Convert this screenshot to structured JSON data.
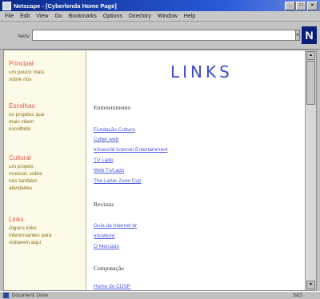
{
  "window": {
    "title": "Netscape - [Cyberlenda Home Page]",
    "min": "_",
    "max": "□",
    "close": "×"
  },
  "menu": [
    "File",
    "Edit",
    "View",
    "Go",
    "Bookmarks",
    "Options",
    "Directory",
    "Window",
    "Help"
  ],
  "toolbar": {
    "address_label": "Netsi",
    "address_value": "",
    "logo": "N",
    "dropdown": "▾"
  },
  "sidebar": [
    {
      "title": "Principal",
      "links": [
        "um pouco mais",
        "sobre nós"
      ]
    },
    {
      "title": "Escolhas",
      "links": [
        "os projetos que",
        "mais vêem",
        "escolhido"
      ]
    },
    {
      "title": "Cultural",
      "links": [
        "um projeto",
        "musical, sobre",
        "nós também",
        "atividades"
      ]
    },
    {
      "title": "Links",
      "links": [
        "Alguns links",
        "interessantes para",
        "visitarem aqui"
      ]
    }
  ],
  "main": {
    "heading": "LINKS",
    "sections": [
      {
        "title": "Entretenimento",
        "links": [
          "Fundação Cultura",
          "Cyber web",
          "Infoworld Internet Entertainment",
          "TV Lado",
          "Web Tv/Lado",
          "The Lazer Zone Cup"
        ]
      },
      {
        "title": "Revistas",
        "links": [
          "Guia da Internet br",
          "InfoWord",
          "O Mercado"
        ]
      },
      {
        "title": "Computação",
        "links": [
          "Home do CDSP"
        ]
      }
    ]
  },
  "status": {
    "text": "Document: Done",
    "right": "S&S"
  }
}
